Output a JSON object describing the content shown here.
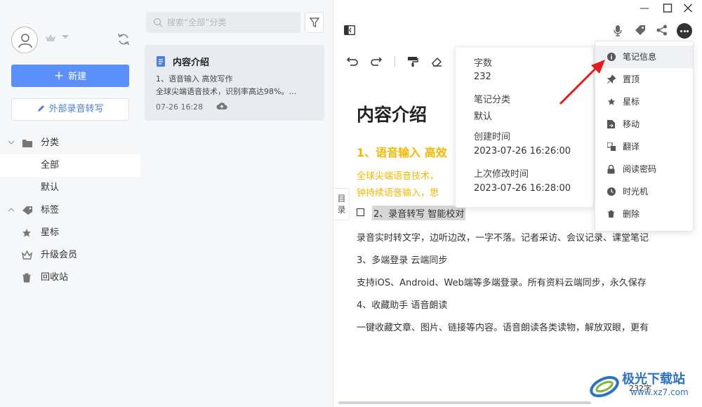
{
  "sidebar": {
    "new_label": "新建",
    "ext_label": "外部录音转写",
    "nav": [
      {
        "label": "分类",
        "icon": "folder-icon"
      },
      {
        "label": "全部"
      },
      {
        "label": "默认"
      },
      {
        "label": "标签",
        "icon": "tag-icon"
      },
      {
        "label": "星标",
        "icon": "star-icon"
      },
      {
        "label": "升级会员",
        "icon": "crown-icon"
      },
      {
        "label": "回收站",
        "icon": "trash-icon"
      }
    ]
  },
  "list": {
    "search_placeholder": "搜索“全部”分类",
    "note": {
      "title": "内容介绍",
      "line1": "1、语音输入 高效写作",
      "line2": "全球尖端语音技术，识别率高达98%。…",
      "time": "07-26 16:28"
    }
  },
  "editor": {
    "toc_label": "目录",
    "heading": "内容介绍",
    "h2": "1、语音输入 高效",
    "yellow_line1": "全球尖端语音技术，",
    "yellow_line2": "钟持续语音输入，思",
    "checkbox_item": "2、录音转写 智能校对",
    "p1": "录音实时转文字，边听边改，一字不落。记者采访、会议记录、课堂笔记",
    "p2": "3、多端登录 云端同步",
    "p3": "支持iOS、Android、Web端等多端登录。所有资料云端同步，永久保存",
    "p4": "4、收藏助手 语音朗读",
    "p5": "一键收藏文章、图片、链接等内容。语音朗读各类读物，解放双眼，更有",
    "word_count": "232字"
  },
  "info": {
    "word_count_label": "字数",
    "word_count": "232",
    "category_label": "笔记分类",
    "category": "默认",
    "created_label": "创建时间",
    "created": "2023-07-26 16:26:00",
    "modified_label": "上次修改时间",
    "modified": "2023-07-26 16:28:00"
  },
  "menu": [
    {
      "label": "笔记信息",
      "icon": "info-icon"
    },
    {
      "label": "置顶",
      "icon": "pin-icon"
    },
    {
      "label": "星标",
      "icon": "star-icon"
    },
    {
      "label": "移动",
      "icon": "move-icon"
    },
    {
      "label": "翻译",
      "icon": "translate-icon"
    },
    {
      "label": "阅读密码",
      "icon": "lock-icon"
    },
    {
      "label": "时光机",
      "icon": "clock-icon"
    },
    {
      "label": "删除",
      "icon": "trash-icon"
    }
  ],
  "watermark": {
    "name": "极光下载站",
    "url": "www.xz7.com"
  },
  "colors": {
    "accent": "#5b8ff9",
    "highlight_yellow": "#f5b800",
    "arrow_red": "#e02020"
  }
}
